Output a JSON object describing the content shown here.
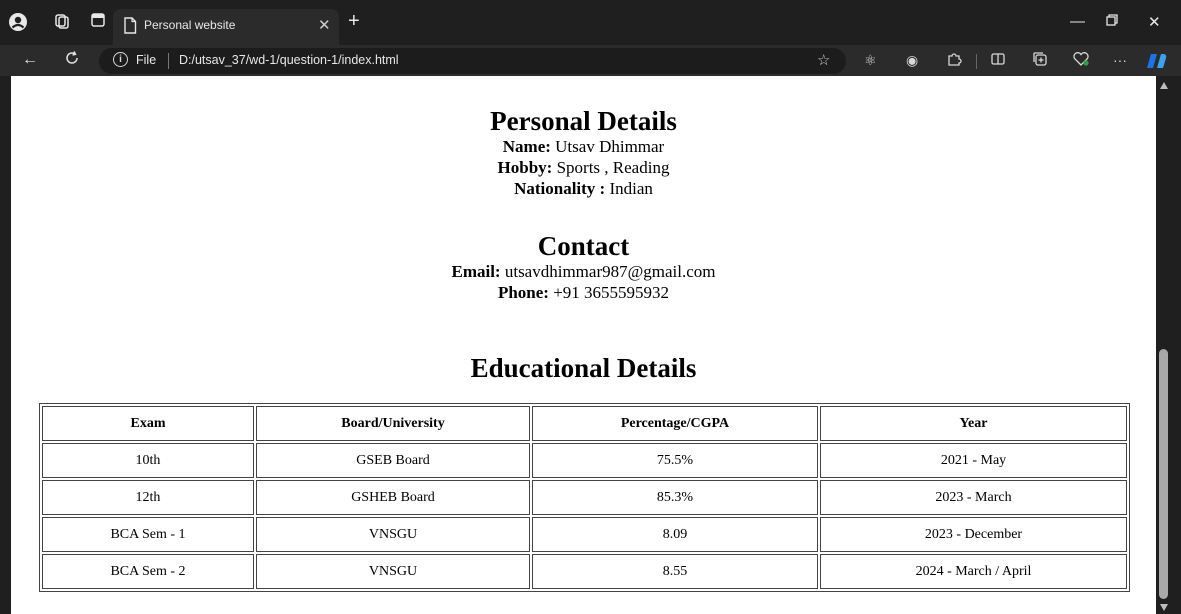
{
  "browser": {
    "tab_title": "Personal website",
    "address_scheme_label": "File",
    "address_url": "D:/utsav_37/wd-1/question-1/index.html"
  },
  "icons": {
    "title_bar": [
      "profile-icon",
      "workspaces-icon",
      "tab-actions-icon",
      "page-icon",
      "close-icon",
      "new-tab-icon",
      "minimize-icon",
      "restore-icon",
      "window-close-icon"
    ],
    "toolbar": [
      "back-icon",
      "refresh-icon",
      "info-icon",
      "favorite-star-icon",
      "react-devtools-icon",
      "extension-icon",
      "extensions-puzzle-icon",
      "split-screen-icon",
      "collections-icon",
      "browser-essentials-icon",
      "more-icon",
      "copilot-icon"
    ]
  },
  "colors": {
    "chrome_bg": "#1f1f1f",
    "tab_bg": "#2b2b2b",
    "page_bg": "#ffffff",
    "copilot_blue": "#1a73e8"
  },
  "personal": {
    "heading": "Personal Details",
    "name_label": "Name:",
    "name_value": "Utsav Dhimmar",
    "hobby_label": "Hobby:",
    "hobby_value": "Sports , Reading",
    "nationality_label": "Nationality :",
    "nationality_value": "Indian"
  },
  "contact": {
    "heading": "Contact",
    "email_label": "Email:",
    "email_value": "utsavdhimmar987@gmail.com",
    "phone_label": "Phone:",
    "phone_value": "+91 3655595932"
  },
  "education": {
    "heading": "Educational Details",
    "columns": [
      "Exam",
      "Board/University",
      "Percentage/CGPA",
      "Year"
    ],
    "rows": [
      [
        "10th",
        "GSEB Board",
        "75.5%",
        "2021 - May"
      ],
      [
        "12th",
        "GSHEB Board",
        "85.3%",
        "2023 - March"
      ],
      [
        "BCA Sem - 1",
        "VNSGU",
        "8.09",
        "2023 - December"
      ],
      [
        "BCA Sem - 2",
        "VNSGU",
        "8.55",
        "2024 - March / April"
      ]
    ]
  }
}
